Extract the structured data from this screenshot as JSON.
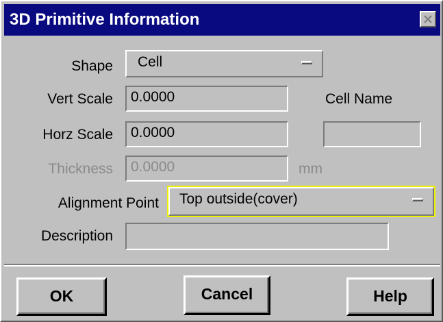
{
  "window": {
    "title": "3D Primitive Information",
    "close_icon": "close-x-icon"
  },
  "form": {
    "shape_label": "Shape",
    "shape_value": "Cell",
    "vert_scale_label": "Vert Scale",
    "vert_scale_value": "0.0000",
    "cell_name_label": "Cell Name",
    "cell_name_value": "",
    "horz_scale_label": "Horz Scale",
    "horz_scale_value": "0.0000",
    "thickness_label": "Thickness",
    "thickness_value": "0.0000",
    "thickness_unit": "mm",
    "alignment_label": "Alignment Point",
    "alignment_value": "Top outside(cover)",
    "description_label": "Description",
    "description_value": ""
  },
  "buttons": {
    "ok": "OK",
    "cancel": "Cancel",
    "help": "Help"
  },
  "colors": {
    "titlebar": "#0a0a80",
    "face": "#c0c0c0",
    "focus": "#f0f000",
    "disabled_text": "#8a8a8a"
  }
}
